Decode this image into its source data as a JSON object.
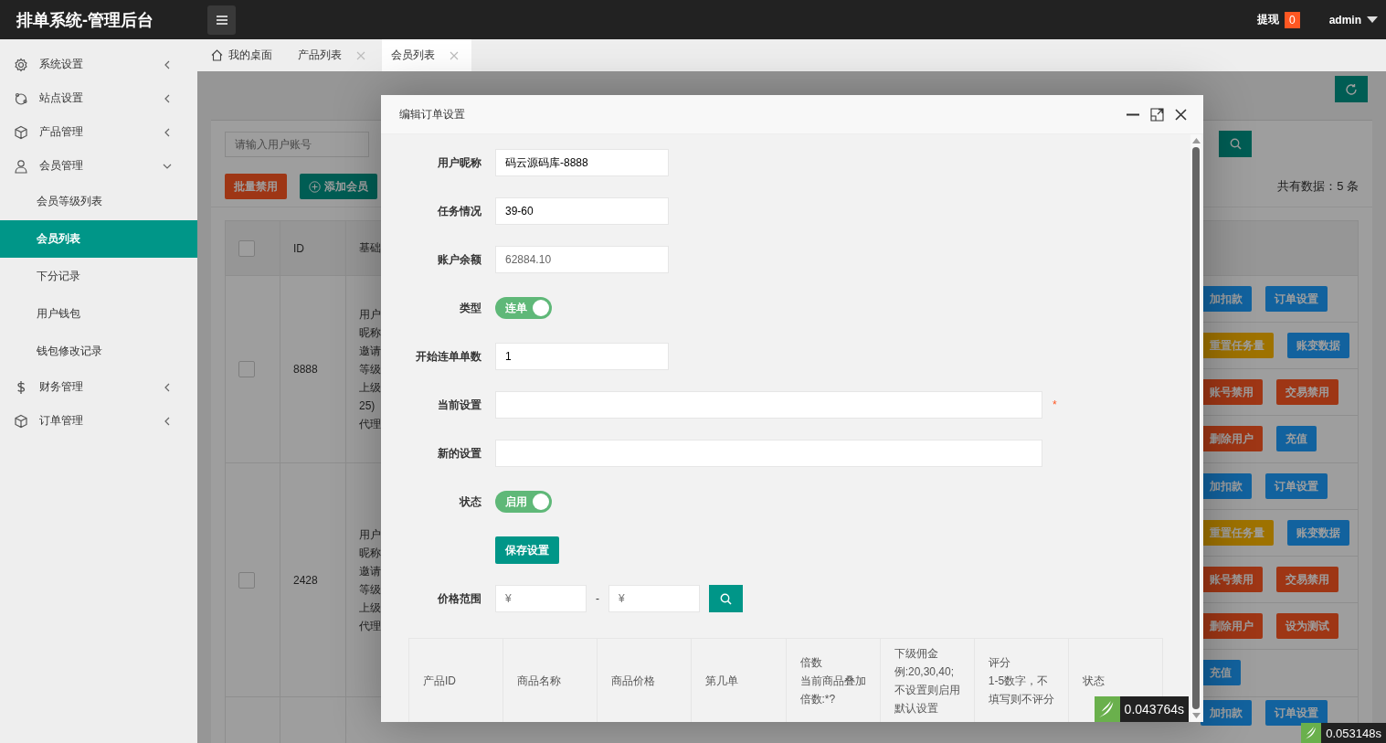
{
  "header": {
    "title": "排单系统-管理后台",
    "withdraw_label": "提现",
    "withdraw_count": "0",
    "user": "admin"
  },
  "sidebar": {
    "items": [
      {
        "label": "系统设置",
        "kind": "gear",
        "expanded": false
      },
      {
        "label": "站点设置",
        "kind": "globe",
        "expanded": false
      },
      {
        "label": "产品管理",
        "kind": "cube",
        "expanded": false
      },
      {
        "label": "会员管理",
        "kind": "user",
        "expanded": true,
        "children": [
          {
            "label": "会员等级列表",
            "selected": false
          },
          {
            "label": "会员列表",
            "selected": true
          },
          {
            "label": "下分记录",
            "selected": false
          },
          {
            "label": "用户钱包",
            "selected": false
          },
          {
            "label": "钱包修改记录",
            "selected": false
          }
        ]
      },
      {
        "label": "财务管理",
        "kind": "dollar",
        "expanded": false
      },
      {
        "label": "订单管理",
        "kind": "cube",
        "expanded": false
      }
    ]
  },
  "tabs": [
    {
      "label": "我的桌面",
      "kind": "home",
      "selected": false
    },
    {
      "label": "产品列表",
      "kind": "page",
      "selected": false
    },
    {
      "label": "会员列表",
      "kind": "page",
      "selected": true
    }
  ],
  "member_page": {
    "search_placeholder": "请输入用户账号",
    "buttons": [
      {
        "label": "批量禁用",
        "kind": "danger",
        "plus": false
      },
      {
        "label": "添加会员",
        "kind": "primary",
        "plus": true
      }
    ],
    "total": "共有数据：5 条",
    "table": {
      "select_all_checked": false,
      "columns": [
        "ID",
        "基础"
      ],
      "rows": [
        {
          "id": "8888",
          "checked": false,
          "base_lines": [
            "用户",
            "昵称",
            "邀请",
            "等级",
            "上级",
            "25)",
            "代理"
          ],
          "actions": [
            [
              {
                "label": "加扣款",
                "kind": "normal"
              },
              {
                "label": "订单设置",
                "kind": "normal"
              }
            ],
            [
              {
                "label": "重置任务量",
                "kind": "warm"
              },
              {
                "label": "账变数据",
                "kind": "normal"
              }
            ],
            [
              {
                "label": "账号禁用",
                "kind": "danger"
              },
              {
                "label": "交易禁用",
                "kind": "danger"
              }
            ],
            [
              {
                "label": "删除用户",
                "kind": "danger"
              },
              {
                "label": "充值",
                "kind": "normal"
              }
            ]
          ]
        },
        {
          "id": "2428",
          "checked": false,
          "base_lines": [
            "用户",
            "昵称",
            "邀请",
            "等级",
            "上级",
            "代理"
          ],
          "actions": [
            [
              {
                "label": "加扣款",
                "kind": "normal"
              },
              {
                "label": "订单设置",
                "kind": "normal"
              }
            ],
            [
              {
                "label": "重置任务量",
                "kind": "warm"
              },
              {
                "label": "账变数据",
                "kind": "normal"
              }
            ],
            [
              {
                "label": "账号禁用",
                "kind": "danger"
              },
              {
                "label": "交易禁用",
                "kind": "danger"
              }
            ],
            [
              {
                "label": "删除用户",
                "kind": "danger"
              },
              {
                "label": "设为测试",
                "kind": "danger"
              }
            ],
            [
              {
                "label": "充值",
                "kind": "normal"
              }
            ]
          ]
        },
        {
          "actions": [
            [
              {
                "label": "加扣款",
                "kind": "normal"
              },
              {
                "label": "订单设置",
                "kind": "normal"
              }
            ]
          ]
        }
      ]
    }
  },
  "dialog": {
    "title": "编辑订单设置",
    "fields": [
      {
        "kind": "text",
        "label": "用户昵称",
        "value": "码云源码库-8888",
        "readonly": false
      },
      {
        "kind": "text",
        "label": "任务情况",
        "value": "39-60",
        "readonly": false
      },
      {
        "kind": "text",
        "label": "账户余额",
        "value": "62884.10",
        "readonly": true
      },
      {
        "kind": "switch",
        "label": "类型",
        "text": "连单",
        "on": true
      },
      {
        "kind": "text",
        "label": "开始连单单数",
        "value": "1",
        "readonly": false
      },
      {
        "kind": "wide",
        "label": "当前设置",
        "required_mark": "*"
      },
      {
        "kind": "wide",
        "label": "新的设置"
      },
      {
        "kind": "switch",
        "label": "状态",
        "text": "启用",
        "on": true
      },
      {
        "kind": "button",
        "label": "保存设置"
      },
      {
        "kind": "range",
        "label": "价格范围",
        "from_placeholder": "¥",
        "separator": "-",
        "to_placeholder": "¥"
      }
    ],
    "columns": [
      [
        "产品ID"
      ],
      [
        "商品名称"
      ],
      [
        "商品价格"
      ],
      [
        "第几单"
      ],
      [
        "倍数",
        "当前商品叠加",
        "倍数:*?"
      ],
      [
        "下级佣金",
        "例:20,30,40;",
        "不设置则启用",
        "默认设置"
      ],
      [
        "评分",
        "1-5数字，不",
        "填写则不评分"
      ],
      [
        "状态"
      ]
    ]
  },
  "timers": [
    "0.043764s",
    "0.053148s"
  ]
}
